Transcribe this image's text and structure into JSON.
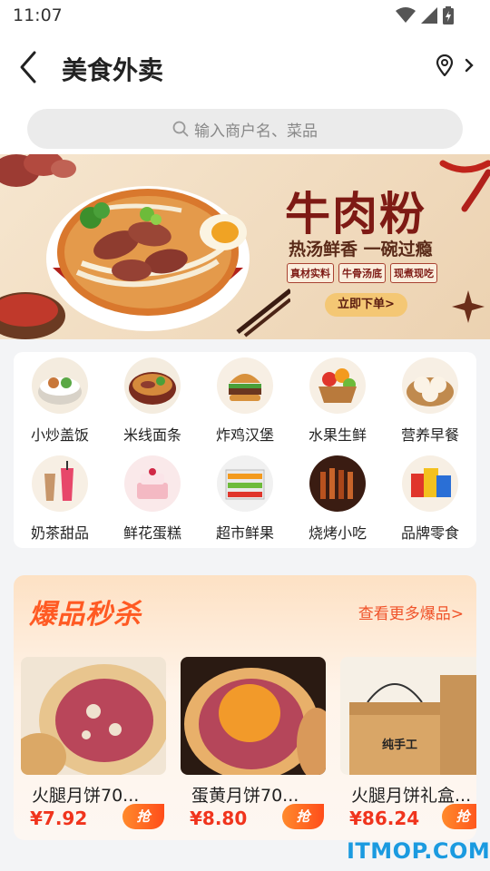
{
  "status": {
    "time": "11:07"
  },
  "header": {
    "title": "美食外卖"
  },
  "search": {
    "placeholder": "输入商户名、菜品"
  },
  "banner": {
    "title": "牛肉粉",
    "subtitle": "热汤鲜香 一碗过瘾",
    "tags": [
      "真材实料",
      "牛骨汤底",
      "现煮现吃"
    ],
    "button": "立即下单>"
  },
  "categories": [
    {
      "label": "小炒盖饭",
      "icon": "rice-bowl-icon"
    },
    {
      "label": "米线面条",
      "icon": "noodle-bowl-icon"
    },
    {
      "label": "炸鸡汉堡",
      "icon": "burger-icon"
    },
    {
      "label": "水果生鲜",
      "icon": "fruit-basket-icon"
    },
    {
      "label": "营养早餐",
      "icon": "dumpling-icon"
    },
    {
      "label": "奶茶甜品",
      "icon": "milk-tea-icon"
    },
    {
      "label": "鲜花蛋糕",
      "icon": "cake-icon"
    },
    {
      "label": "超市鲜果",
      "icon": "supermarket-icon"
    },
    {
      "label": "烧烤小吃",
      "icon": "bbq-icon"
    },
    {
      "label": "品牌零食",
      "icon": "snacks-icon"
    }
  ],
  "flash_sale": {
    "title": "爆品秒杀",
    "more": "查看更多爆品>",
    "products": [
      {
        "name": "火腿月饼70...",
        "price": "¥7.92",
        "button": "抢"
      },
      {
        "name": "蛋黄月饼70...",
        "price": "¥8.80",
        "button": "抢"
      },
      {
        "name": "火腿月饼礼盒...",
        "price": "¥86.24",
        "button": "抢",
        "box_label": "纯手工"
      }
    ]
  },
  "watermark": "ITMOP.COM",
  "colors": {
    "accent": "#ff5a23",
    "price": "#f0341d",
    "banner_title": "#7e1a14"
  }
}
